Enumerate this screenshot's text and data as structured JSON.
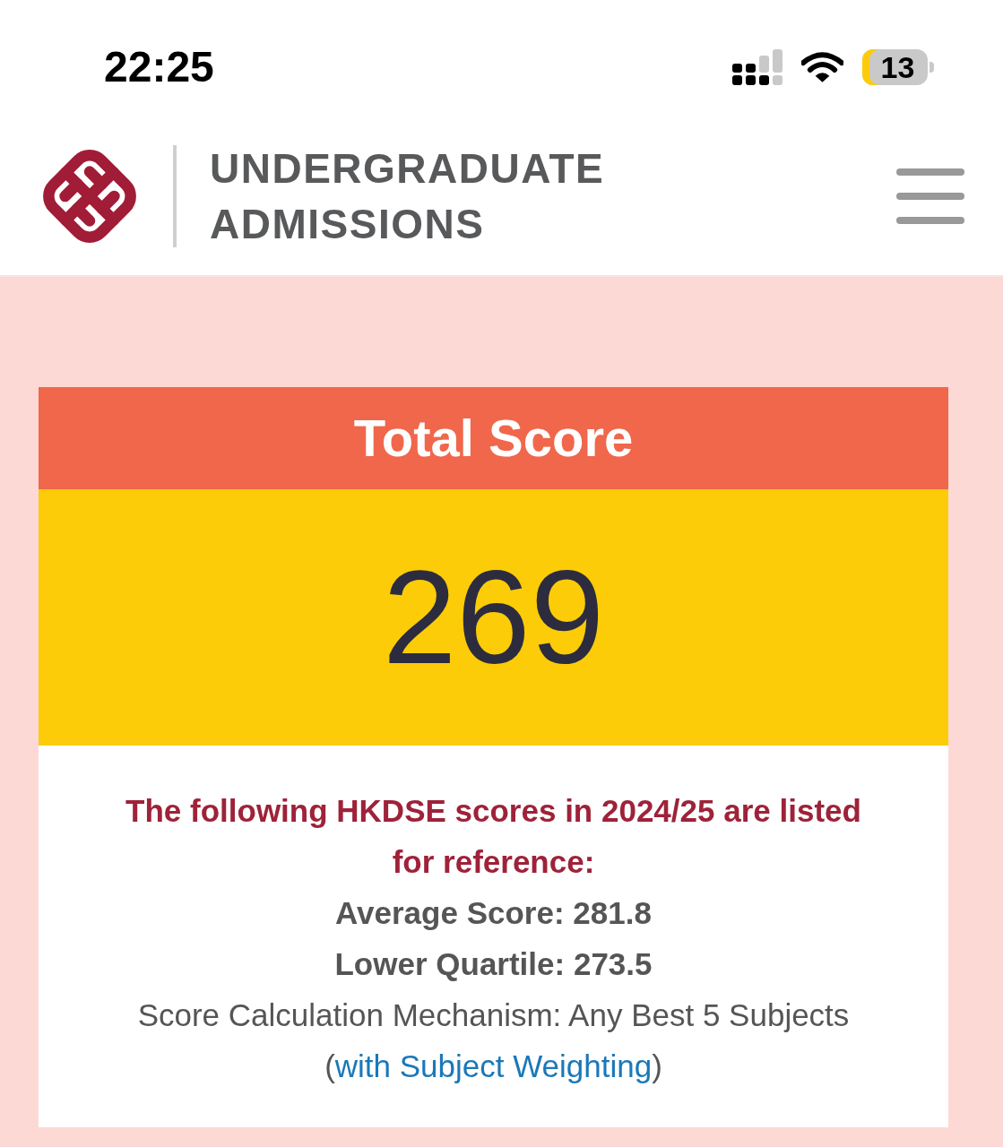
{
  "status_bar": {
    "time": "22:25",
    "battery": "13"
  },
  "header": {
    "title_lines": [
      "UNDERGRADUATE",
      "ADMISSIONS"
    ]
  },
  "score_card": {
    "title": "Total Score",
    "score": "269",
    "note": "The following HKDSE scores in 2024/25 are listed for reference:",
    "stats": [
      "Average Score: 281.8",
      "Lower Quartile: 273.5"
    ],
    "mechanism": {
      "before": "Score Calculation Mechanism: Any Best 5 Subjects (",
      "link": "with Subject Weighting",
      "after": ")"
    }
  }
}
